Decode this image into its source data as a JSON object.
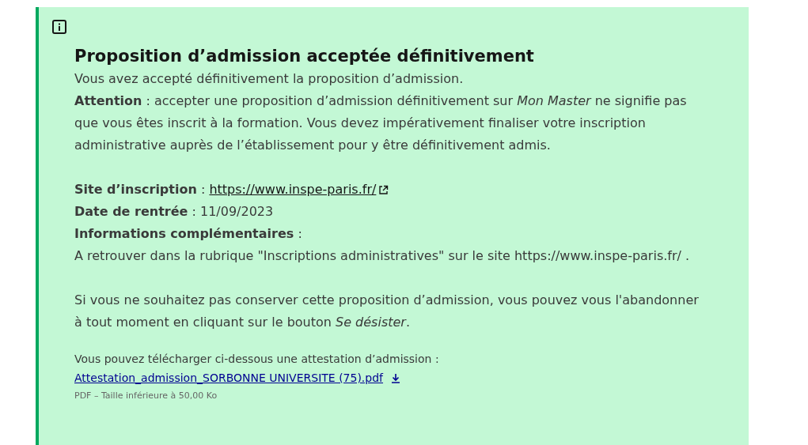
{
  "notice": {
    "title": "Proposition d’admission acceptée définitivement",
    "intro": [
      "Vous avez accepté définitivement la proposition d’admission.",
      "**Attention** : accepter une proposition d’admission définitivement sur *Mon Master* ne signifie pas que vous êtes inscrit à la formation. Vous devez impérativement finaliser votre inscription administrative auprès de l’établissement pour y être définitivement admis."
    ],
    "site": {
      "label": "**Site d’inscription** :",
      "link": "https://www.inspe-paris.fr/"
    },
    "date": "**Date de rentrée** : 11/09/2023",
    "info_label": "**Informations complémentaires** :",
    "info_text": "A retrouver dans la rubrique \"Inscriptions administratives\" sur le site https://www.inspe-paris.fr/ .",
    "withdraw": "Si vous ne souhaitez pas conserver cette proposition d’admission, vous pouvez vous l'abandonner à tout moment en cliquant sur le bouton *Se désister*.",
    "download": {
      "intro": "Vous pouvez télécharger ci-dessous une attestation d’admission :",
      "link": "Attestation_admission_SORBONNE UNIVERSITE (75).pdf",
      "meta": "PDF – Taille inférieure à 50,00 Ko"
    }
  }
}
